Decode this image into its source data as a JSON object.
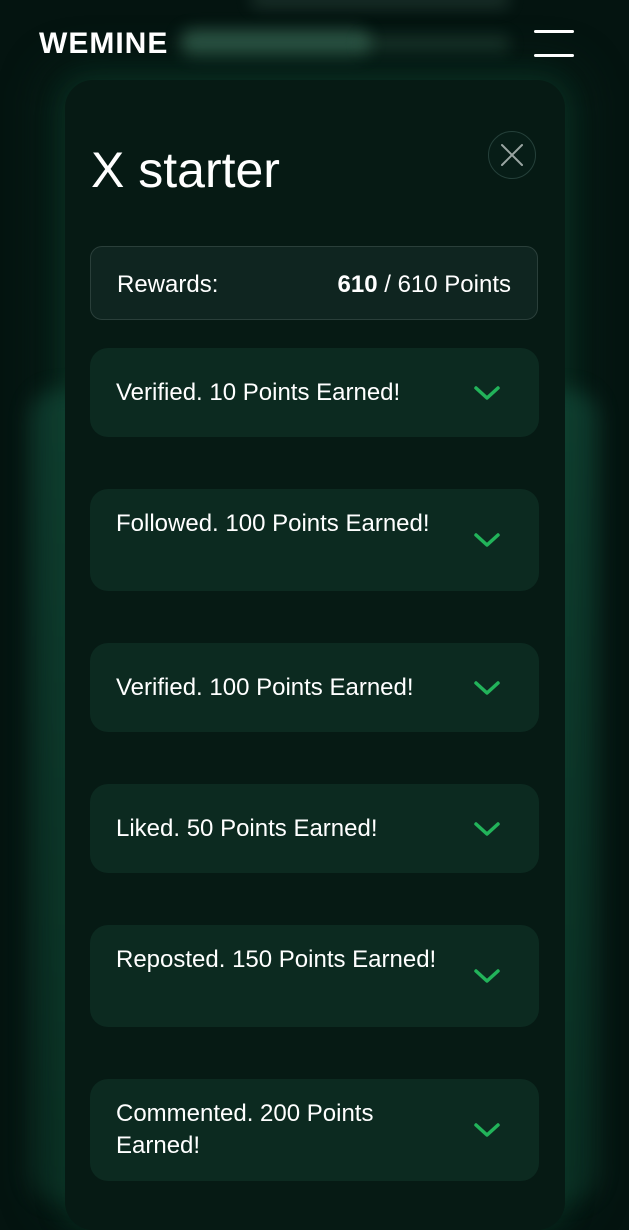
{
  "header": {
    "logo": "WEMINE"
  },
  "modal": {
    "title": "X starter",
    "rewards": {
      "label": "Rewards:",
      "earned": "610",
      "separator": " / ",
      "total": "610 Points"
    },
    "tasks": [
      {
        "label": "Verified. 10 Points Earned!",
        "status": "completed"
      },
      {
        "label": "Followed. 100 Points Earned!",
        "status": "completed"
      },
      {
        "label": "Verified. 100 Points Earned!",
        "status": "completed"
      },
      {
        "label": "Liked. 50 Points Earned!",
        "status": "completed"
      },
      {
        "label": "Reposted. 150 Points Earned!",
        "status": "completed"
      },
      {
        "label": "Commented. 200 Points Earned!",
        "status": "completed"
      }
    ]
  },
  "colors": {
    "background": "#041410",
    "modal_background": "#061a14",
    "task_background": "#0c2a20",
    "check_accent": "#22b35a"
  },
  "icons": {
    "menu": "hamburger-menu-icon",
    "close": "close-icon",
    "task_status": "chevron-down-icon"
  }
}
